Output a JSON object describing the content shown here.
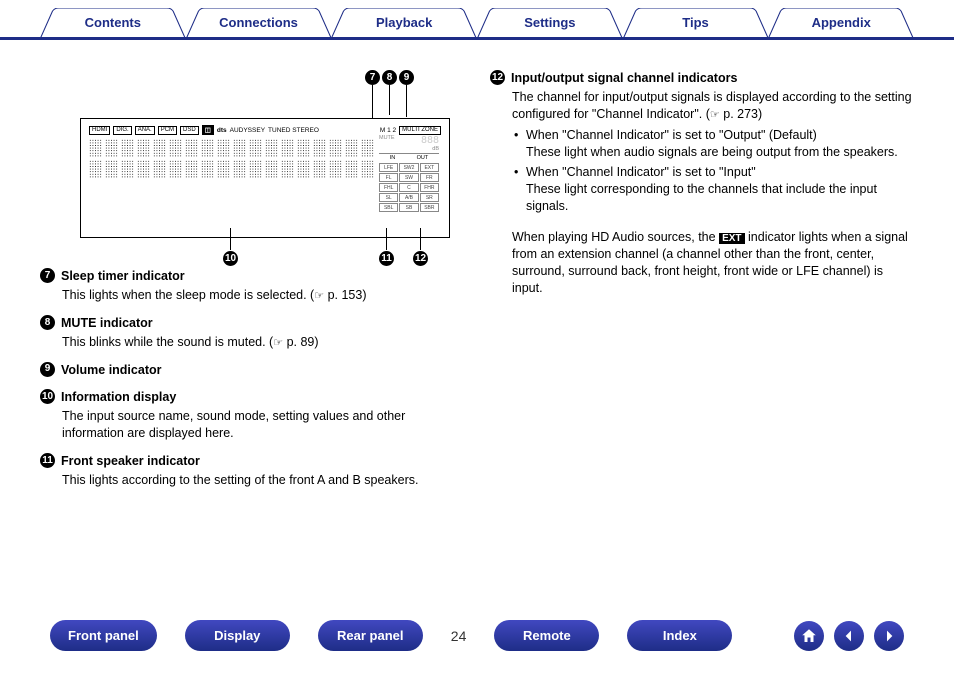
{
  "nav": {
    "tabs": [
      "Contents",
      "Connections",
      "Playback",
      "Settings",
      "Tips",
      "Appendix"
    ]
  },
  "diagram": {
    "top_labels": [
      "HDMI",
      "DIG.",
      "ANA.",
      "PCM",
      "DSD"
    ],
    "top_text1": "dts",
    "top_text2": "AUDYSSEY",
    "top_text3": "TUNED STEREO",
    "top_text4": "M 1 2",
    "top_text5": "MULTI ZONE",
    "callouts_top": [
      "7",
      "8",
      "9"
    ],
    "callouts_bot": [
      "10",
      "11",
      "12"
    ],
    "right_panel": {
      "mute": "MUTE",
      "db": "dB",
      "in": "IN",
      "out": "OUT",
      "rows": [
        [
          "LFE",
          "SW2",
          "EXT"
        ],
        [
          "FL",
          "SW",
          "FR"
        ],
        [
          "FHL",
          "C",
          "FHR"
        ],
        [
          "SL",
          "A/B",
          "SR"
        ],
        [
          "SBL",
          "SB",
          "SBR"
        ]
      ]
    }
  },
  "items_left": [
    {
      "num": "7",
      "title": "Sleep timer indicator",
      "body": "This lights when the sleep mode is selected.",
      "pref": "p. 153"
    },
    {
      "num": "8",
      "title": "MUTE indicator",
      "body": "This blinks while the sound is muted.",
      "pref": "p. 89"
    },
    {
      "num": "9",
      "title": "Volume indicator",
      "body": ""
    },
    {
      "num": "10",
      "title": "Information display",
      "body": "The input source name, sound mode, setting values and other information are displayed here."
    },
    {
      "num": "11",
      "title": "Front speaker indicator",
      "body": "This lights according to the setting of the front A and B speakers."
    }
  ],
  "item_right": {
    "num": "12",
    "title": "Input/output signal channel indicators",
    "line1": "The channel for input/output signals is displayed according to the setting configured for \"Channel Indicator\".",
    "pref": "p. 273",
    "sub1_head": "When \"Channel Indicator\" is set to \"Output\" (Default)",
    "sub1_body": "These light when audio signals are being output from the speakers.",
    "sub2_head": "When \"Channel Indicator\" is set to \"Input\"",
    "sub2_body": "These light corresponding to the channels that include the input signals.",
    "note1": "When playing HD Audio sources, the",
    "note_badge": "EXT",
    "note2": "indicator lights when a signal from an extension channel (a channel other than the front, center, surround, surround back, front height, front wide or LFE channel) is input."
  },
  "bottom": {
    "buttons": [
      "Front panel",
      "Display",
      "Rear panel",
      "Remote",
      "Index"
    ],
    "page": "24"
  }
}
